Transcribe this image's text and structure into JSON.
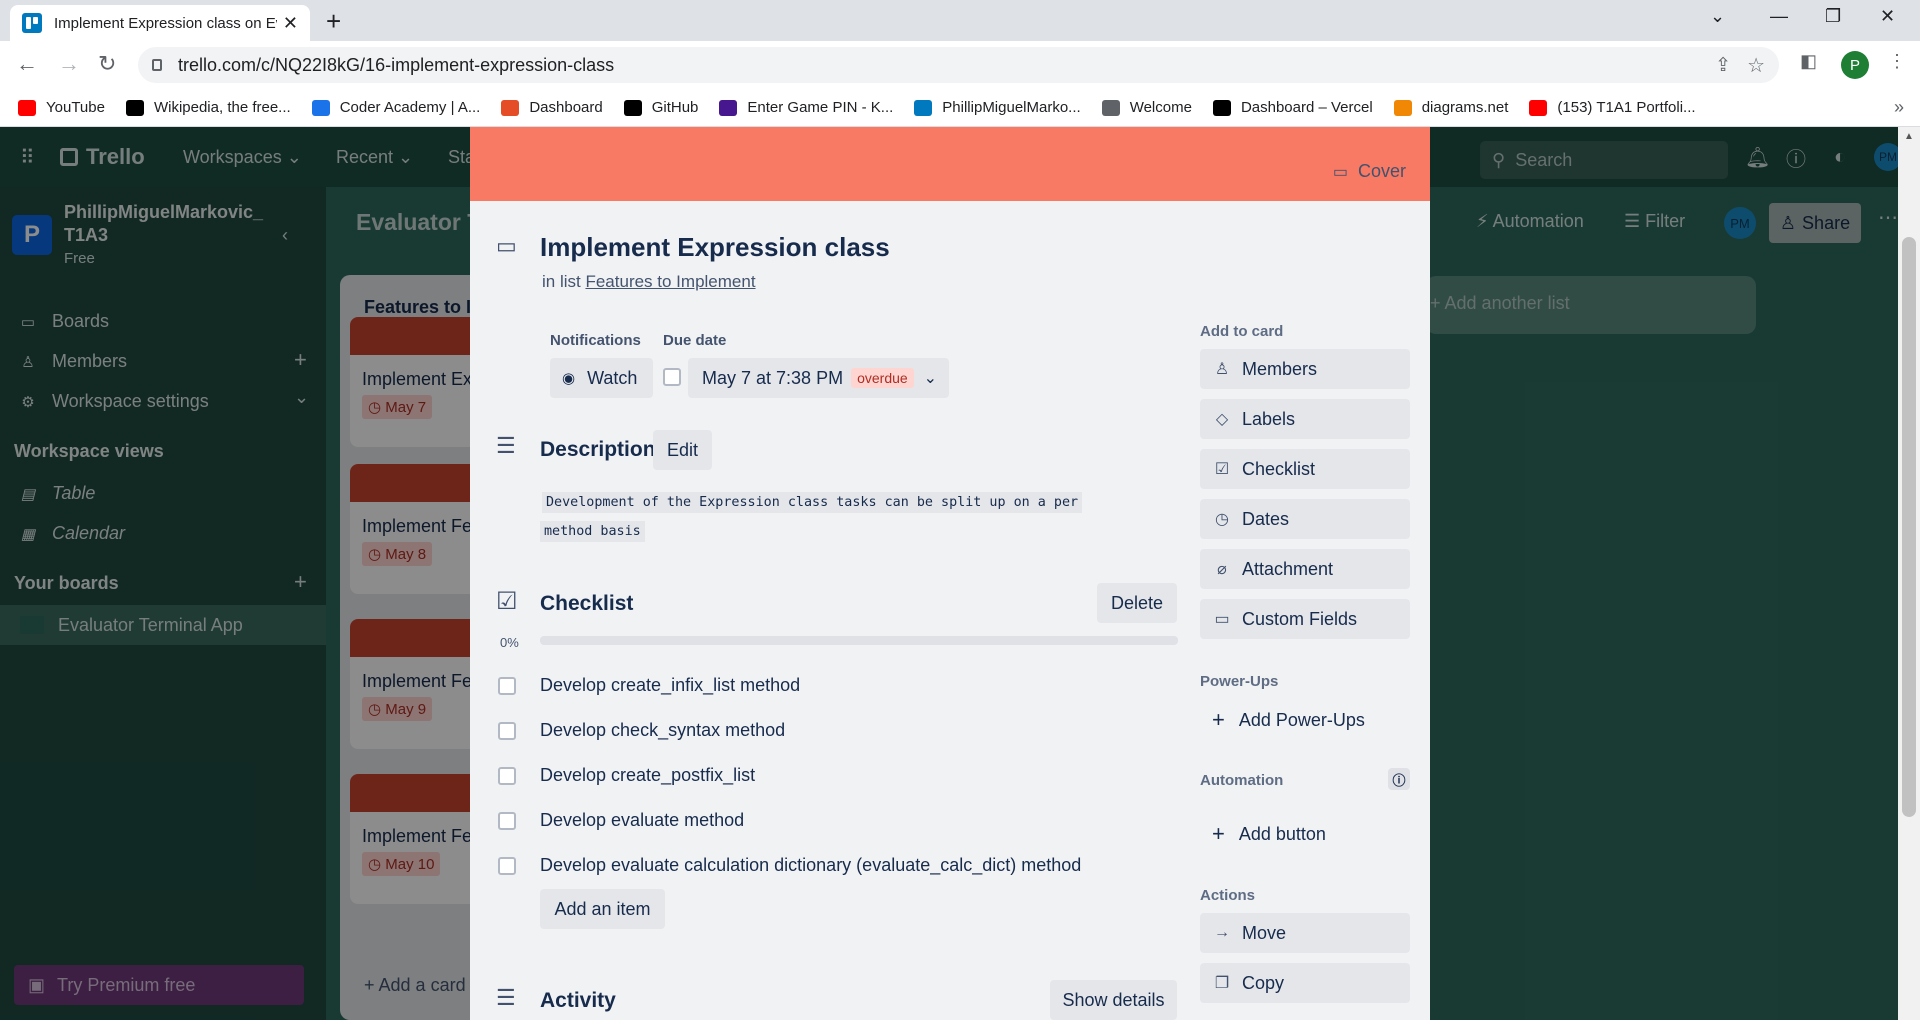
{
  "browser": {
    "tab_title": "Implement Expression class on Ev",
    "url": "trello.com/c/NQ22I8kG/16-implement-expression-class",
    "bookmarks": [
      {
        "label": "YouTube",
        "icon": "youtube-icon",
        "color": "#ff0000"
      },
      {
        "label": "Wikipedia, the free...",
        "icon": "wikipedia-icon",
        "color": "#000000"
      },
      {
        "label": "Coder Academy | A...",
        "icon": "coder-academy-icon",
        "color": "#1a73e8"
      },
      {
        "label": "Dashboard",
        "icon": "dashboard-icon",
        "color": "#e44d26"
      },
      {
        "label": "GitHub",
        "icon": "github-icon",
        "color": "#000000"
      },
      {
        "label": "Enter Game PIN - K...",
        "icon": "kahoot-icon",
        "color": "#46178f"
      },
      {
        "label": "PhillipMiguelMarko...",
        "icon": "trello-icon",
        "color": "#0079bf"
      },
      {
        "label": "Welcome",
        "icon": "globe-icon",
        "color": "#5f6368"
      },
      {
        "label": "Dashboard – Vercel",
        "icon": "vercel-icon",
        "color": "#000000"
      },
      {
        "label": "diagrams.net",
        "icon": "drawio-icon",
        "color": "#f08705"
      },
      {
        "label": "(153) T1A1 Portfoli...",
        "icon": "youtube-icon",
        "color": "#ff0000"
      }
    ],
    "profile_letter": "P"
  },
  "trello": {
    "logo": "Trello",
    "nav": [
      "Workspaces",
      "Recent",
      "Sta"
    ],
    "search_placeholder": "Search",
    "workspace_name": "PhillipMiguelMarkovic_T1A3",
    "workspace_plan": "Free",
    "workspace_letter": "P",
    "sidebar_items": [
      "Boards",
      "Members",
      "Workspace settings"
    ],
    "workspace_views_title": "Workspace views",
    "views": [
      "Table",
      "Calendar"
    ],
    "your_boards_title": "Your boards",
    "boards": [
      "Evaluator Terminal App"
    ],
    "premium": "Try Premium free",
    "board_title": "Evaluator T",
    "board_actions": [
      "Automation",
      "Filter",
      "Share"
    ],
    "avatar": "PM",
    "add_list": "Add another list",
    "list_title": "Features to In",
    "list_cards": [
      {
        "title": "Implement Ex",
        "date": "May 7"
      },
      {
        "title": "Implement Fe Input/Output",
        "date": "May 8"
      },
      {
        "title": "Implement Fe Mode",
        "date": "May 9"
      },
      {
        "title": "Implement Fe Variable Supp",
        "date": "May 10"
      }
    ],
    "add_card": "Add a card"
  },
  "card": {
    "cover_label": "Cover",
    "title": "Implement Expression class",
    "in_list_prefix": "in list",
    "list_name": "Features to Implement",
    "notifications_label": "Notifications",
    "watch_label": "Watch",
    "due_date_label": "Due date",
    "due_date_value": "May 7 at 7:38 PM",
    "overdue_label": "overdue",
    "description_title": "Description",
    "edit_label": "Edit",
    "description_line1": "Development of the Expression class tasks can be split up on a per",
    "description_line2": "method basis",
    "checklist_title": "Checklist",
    "delete_label": "Delete",
    "progress_label": "0%",
    "progress": 0,
    "checklist_items": [
      "Develop create_infix_list method",
      "Develop check_syntax method",
      "Develop create_postfix_list",
      "Develop evaluate method",
      "Develop evaluate calculation dictionary (evaluate_calc_dict) method"
    ],
    "add_item_label": "Add an item",
    "activity_title": "Activity",
    "show_details_label": "Show details"
  },
  "side": {
    "add_to_card_title": "Add to card",
    "add_to_card": [
      {
        "label": "Members",
        "icon": "person-icon"
      },
      {
        "label": "Labels",
        "icon": "tag-icon"
      },
      {
        "label": "Checklist",
        "icon": "checklist-icon"
      },
      {
        "label": "Dates",
        "icon": "clock-icon"
      },
      {
        "label": "Attachment",
        "icon": "paperclip-icon"
      },
      {
        "label": "Custom Fields",
        "icon": "custom-fields-icon"
      }
    ],
    "powerups_title": "Power-Ups",
    "add_powerups": "Add Power-Ups",
    "automation_title": "Automation",
    "add_button": "Add button",
    "actions_title": "Actions",
    "actions": [
      {
        "label": "Move",
        "icon": "arrow-right-icon"
      },
      {
        "label": "Copy",
        "icon": "copy-icon"
      }
    ]
  }
}
